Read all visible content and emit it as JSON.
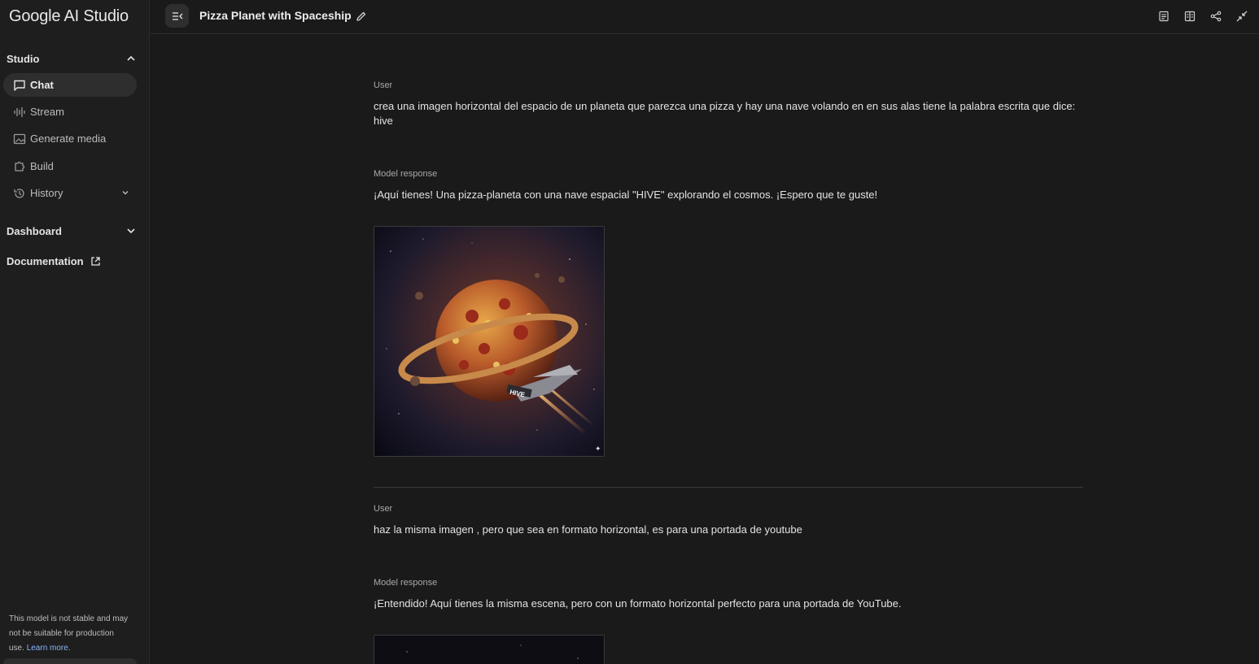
{
  "app": {
    "brand": "Google AI Studio"
  },
  "sidebar": {
    "studio_label": "Studio",
    "items": [
      {
        "label": "Chat",
        "icon": "chat-icon",
        "active": true
      },
      {
        "label": "Stream",
        "icon": "waveform-icon"
      },
      {
        "label": "Generate media",
        "icon": "image-icon"
      },
      {
        "label": "Build",
        "icon": "puzzle-icon"
      },
      {
        "label": "History",
        "icon": "history-icon"
      }
    ],
    "dashboard_label": "Dashboard",
    "documentation_label": "Documentation",
    "notice_text": "This model is not stable and may not be suitable for production use.",
    "notice_link": "Learn more."
  },
  "header": {
    "title": "Pizza Planet with Spaceship"
  },
  "conversation": [
    {
      "role": "User",
      "text": "crea una imagen horizontal del espacio de un planeta que parezca una pizza y hay una nave volando en en sus alas tiene la palabra escrita que dice: hive"
    },
    {
      "role": "Model response",
      "text": "¡Aquí tienes! Una pizza-planeta con una nave espacial \"HIVE\" explorando el cosmos. ¡Espero que te guste!",
      "image_caption": "HIVE"
    },
    {
      "role": "User",
      "text": "haz la misma imagen , pero que sea en formato horizontal, es para una portada de youtube"
    },
    {
      "role": "Model response",
      "text": "¡Entendido! Aquí tienes la misma escena, pero con un formato horizontal perfecto para una portada de YouTube."
    }
  ],
  "colors": {
    "background": "#1a1a1a",
    "sidebar": "#1e1e1e",
    "active_item": "#2e2e2e",
    "link": "#8ab4f8"
  }
}
